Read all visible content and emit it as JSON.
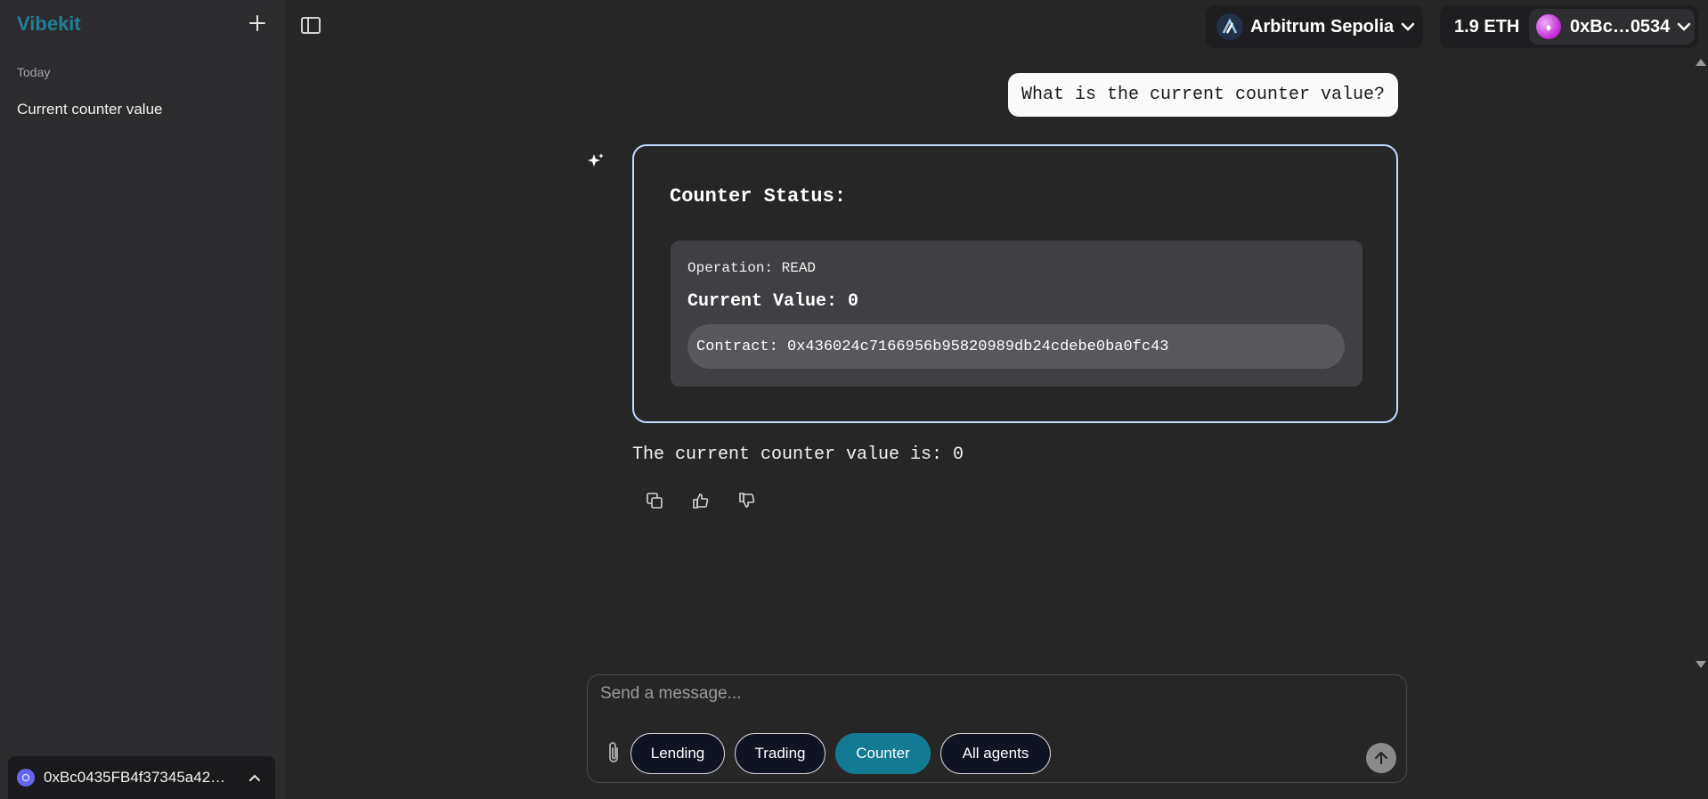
{
  "sidebar": {
    "brand": "Vibekit",
    "section_label": "Today",
    "history": [
      {
        "label": "Current counter value"
      }
    ],
    "wallet_address": "0xBc0435FB4f37345a42…"
  },
  "topbar": {
    "network": "Arbitrum Sepolia",
    "balance": "1.9 ETH",
    "account": "0xBc…0534"
  },
  "chat": {
    "user_message": "What is the current counter value?",
    "card": {
      "title": "Counter Status:",
      "operation": "Operation: READ",
      "current_value": "Current Value: 0",
      "contract": "Contract: 0x436024c7166956b95820989db24cdebe0ba0fc43"
    },
    "answer": "The current counter value is: 0",
    "actions": [
      "copy-icon",
      "thumbs-up-icon",
      "thumbs-down-icon"
    ]
  },
  "composer": {
    "placeholder": "Send a message...",
    "chips": [
      {
        "label": "Lending",
        "active": false
      },
      {
        "label": "Trading",
        "active": false
      },
      {
        "label": "Counter",
        "active": true
      },
      {
        "label": "All agents",
        "active": false
      }
    ]
  },
  "colors": {
    "brand": "#1f7f96",
    "active_chip": "#137a94",
    "card_border": "#bfdbfe",
    "background": "#262626",
    "sidebar": "#2c2c2e"
  }
}
